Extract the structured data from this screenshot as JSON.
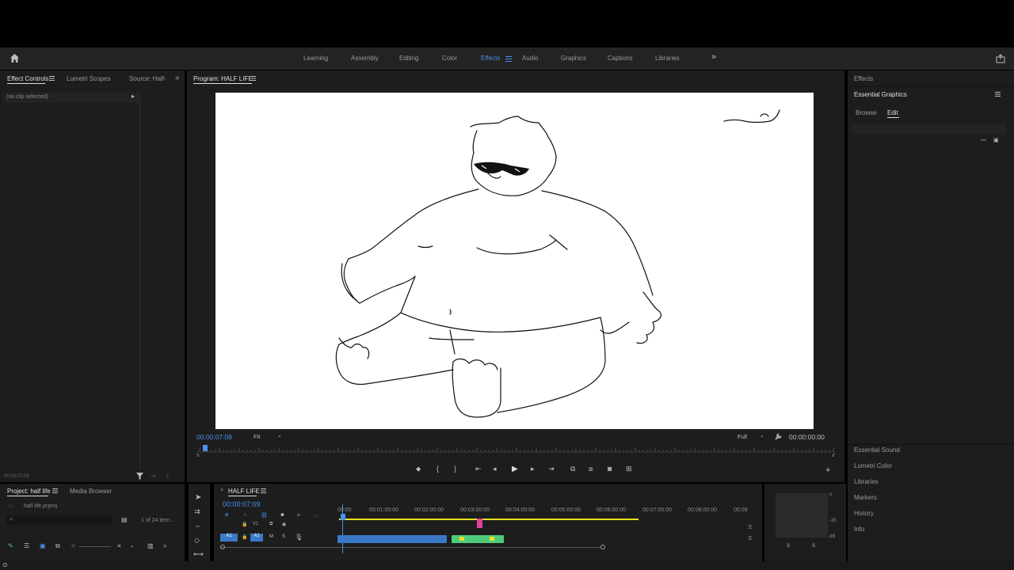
{
  "workspace_tabs": [
    {
      "label": "Learning",
      "active": false
    },
    {
      "label": "Assembly",
      "active": false
    },
    {
      "label": "Editing",
      "active": false
    },
    {
      "label": "Color",
      "active": false
    },
    {
      "label": "Effects",
      "active": true
    },
    {
      "label": "Audio",
      "active": false
    },
    {
      "label": "Graphics",
      "active": false
    },
    {
      "label": "Captions",
      "active": false
    },
    {
      "label": "Libraries",
      "active": false
    }
  ],
  "source_panel": {
    "tabs": [
      "Effect Controls",
      "Lumetri Scopes",
      "Source: Half-"
    ],
    "empty_label": "(no clip selected)",
    "timecode": "00:00:07:09"
  },
  "program_monitor": {
    "title": "Program: HALF LIFE",
    "current_time": "00:00:07:09",
    "zoom_label": "Fit",
    "resolution_label": "Full",
    "duration": "00:00:00:00"
  },
  "project_panel": {
    "tabs": [
      "Project: half life",
      "Media Browser"
    ],
    "project_file": "half life.prproj",
    "item_count": "1 of 24 item..."
  },
  "timeline": {
    "sequence_name": "HALF LIFE",
    "timecode": "00:00:07:09",
    "ruler_labels": [
      "00:00",
      "00:01:00:00",
      "00:02:00:00",
      "00:03:00:00",
      "00:04:00:00",
      "00:05:00:00",
      "00:06:00:00",
      "00:07:00:00",
      "00:08:00:00",
      "00:09"
    ],
    "track_labels": {
      "video": "V1",
      "audio": "A1"
    }
  },
  "right_panel": {
    "effects_title": "Effects",
    "essential_graphics_title": "Essential Graphics",
    "eg_tabs": [
      "Browse",
      "Edit"
    ],
    "collapsed_panels": [
      "Essential Sound",
      "Lumetri Color",
      "Libraries",
      "Markers",
      "History",
      "Info"
    ]
  },
  "audio_meter": {
    "scale": [
      "0",
      "-36",
      "dB"
    ],
    "channels": [
      "S",
      "S"
    ]
  },
  "canvas_text": "بعد",
  "colors": {
    "accent": "#4a8ff2",
    "panel_bg": "#1d1d1d",
    "playhead_pink": "#e040a0",
    "work_area_yellow": "#e8e020",
    "clip_green": "#4ecb7a",
    "clip_blue": "#3a79c7"
  }
}
